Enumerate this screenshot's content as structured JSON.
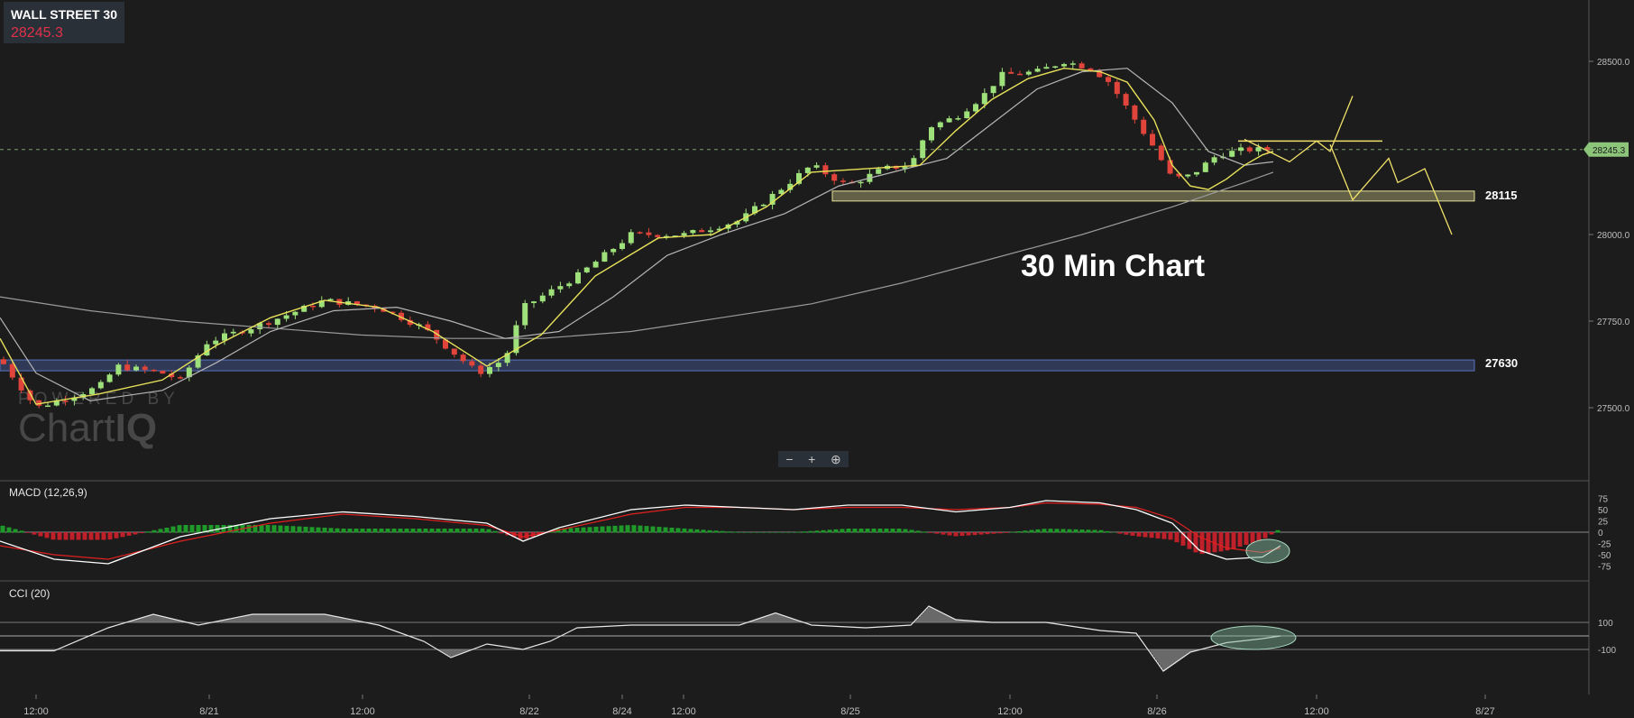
{
  "header": {
    "title": "WALL STREET 30",
    "price": "28245.3"
  },
  "annotation": "30 Min Chart",
  "watermark": {
    "top": "POWERED BY",
    "brand_left": "Chart",
    "brand_right": "IQ"
  },
  "zoom": {
    "minus": "−",
    "plus": "+",
    "reset": "⊕"
  },
  "colors": {
    "up": "#9ee07a",
    "down": "#e0443a",
    "ma_fast": "#e8e25a",
    "ma_slow": "#b5b5b5",
    "macd_line": "#ffffff",
    "signal_line": "#e02020",
    "support_zone": "#e6e39a",
    "lower_zone": "#4a5fa0",
    "price_badge": "#8cc47a"
  },
  "chart_data": [
    {
      "type": "candlestick",
      "title": "WALL STREET 30",
      "ylim": [
        27250,
        28600
      ],
      "y_ticks": [
        "28500.0",
        "28000.0",
        "27750.0",
        "27500.0"
      ],
      "x_ticks": [
        "12:00",
        "8/21",
        "12:00",
        "8/22",
        "8/24",
        "12:00",
        "8/25",
        "12:00",
        "8/26",
        "12:00",
        "8/27"
      ],
      "last_price_label": "28245.3",
      "levels": [
        {
          "label": "28115",
          "value": 28115
        },
        {
          "label": "27630",
          "value": 27630
        }
      ],
      "anchors": [
        {
          "x": 0,
          "y": 27640
        },
        {
          "x": 40,
          "y": 27500
        },
        {
          "x": 110,
          "y": 27560
        },
        {
          "x": 130,
          "y": 27620
        },
        {
          "x": 180,
          "y": 27600
        },
        {
          "x": 200,
          "y": 27580
        },
        {
          "x": 230,
          "y": 27690
        },
        {
          "x": 300,
          "y": 27750
        },
        {
          "x": 360,
          "y": 27810
        },
        {
          "x": 420,
          "y": 27790
        },
        {
          "x": 470,
          "y": 27730
        },
        {
          "x": 530,
          "y": 27600
        },
        {
          "x": 560,
          "y": 27640
        },
        {
          "x": 580,
          "y": 27790
        },
        {
          "x": 640,
          "y": 27880
        },
        {
          "x": 700,
          "y": 28000
        },
        {
          "x": 760,
          "y": 28000
        },
        {
          "x": 820,
          "y": 28040
        },
        {
          "x": 860,
          "y": 28120
        },
        {
          "x": 900,
          "y": 28200
        },
        {
          "x": 940,
          "y": 28140
        },
        {
          "x": 980,
          "y": 28190
        },
        {
          "x": 1010,
          "y": 28200
        },
        {
          "x": 1030,
          "y": 28310
        },
        {
          "x": 1060,
          "y": 28340
        },
        {
          "x": 1090,
          "y": 28400
        },
        {
          "x": 1110,
          "y": 28460
        },
        {
          "x": 1150,
          "y": 28470
        },
        {
          "x": 1180,
          "y": 28500
        },
        {
          "x": 1210,
          "y": 28480
        },
        {
          "x": 1230,
          "y": 28440
        },
        {
          "x": 1280,
          "y": 28250
        },
        {
          "x": 1300,
          "y": 28160
        },
        {
          "x": 1320,
          "y": 28170
        },
        {
          "x": 1350,
          "y": 28230
        },
        {
          "x": 1380,
          "y": 28245
        },
        {
          "x": 1412,
          "y": 28245
        }
      ],
      "ma_fast": [
        [
          0,
          27700
        ],
        [
          40,
          27510
        ],
        [
          110,
          27540
        ],
        [
          180,
          27580
        ],
        [
          240,
          27680
        ],
        [
          300,
          27760
        ],
        [
          360,
          27810
        ],
        [
          420,
          27790
        ],
        [
          480,
          27720
        ],
        [
          540,
          27620
        ],
        [
          600,
          27710
        ],
        [
          660,
          27880
        ],
        [
          730,
          27990
        ],
        [
          790,
          28000
        ],
        [
          850,
          28080
        ],
        [
          900,
          28180
        ],
        [
          960,
          28190
        ],
        [
          1020,
          28200
        ],
        [
          1060,
          28300
        ],
        [
          1100,
          28390
        ],
        [
          1140,
          28450
        ],
        [
          1180,
          28480
        ],
        [
          1220,
          28470
        ],
        [
          1250,
          28440
        ],
        [
          1280,
          28330
        ],
        [
          1300,
          28200
        ],
        [
          1320,
          28140
        ],
        [
          1340,
          28130
        ],
        [
          1360,
          28160
        ],
        [
          1380,
          28200
        ],
        [
          1400,
          28230
        ],
        [
          1412,
          28240
        ]
      ],
      "ma_slow": [
        [
          0,
          27760
        ],
        [
          40,
          27600
        ],
        [
          100,
          27520
        ],
        [
          180,
          27550
        ],
        [
          240,
          27630
        ],
        [
          300,
          27720
        ],
        [
          370,
          27780
        ],
        [
          440,
          27790
        ],
        [
          500,
          27750
        ],
        [
          560,
          27700
        ],
        [
          620,
          27720
        ],
        [
          680,
          27820
        ],
        [
          740,
          27940
        ],
        [
          800,
          28000
        ],
        [
          870,
          28060
        ],
        [
          930,
          28140
        ],
        [
          990,
          28180
        ],
        [
          1050,
          28220
        ],
        [
          1100,
          28320
        ],
        [
          1150,
          28420
        ],
        [
          1200,
          28470
        ],
        [
          1250,
          28480
        ],
        [
          1300,
          28380
        ],
        [
          1340,
          28240
        ],
        [
          1380,
          28200
        ],
        [
          1412,
          28210
        ]
      ],
      "ma_long": [
        [
          0,
          27820
        ],
        [
          100,
          27780
        ],
        [
          200,
          27750
        ],
        [
          300,
          27730
        ],
        [
          400,
          27710
        ],
        [
          500,
          27700
        ],
        [
          600,
          27700
        ],
        [
          700,
          27720
        ],
        [
          800,
          27760
        ],
        [
          900,
          27800
        ],
        [
          1000,
          27860
        ],
        [
          1100,
          27930
        ],
        [
          1200,
          28000
        ],
        [
          1300,
          28080
        ],
        [
          1380,
          28150
        ],
        [
          1412,
          28180
        ]
      ],
      "forecast_up": [
        [
          1380,
          28275
        ],
        [
          1430,
          28210
        ],
        [
          1460,
          28270
        ],
        [
          1475,
          28240
        ],
        [
          1500,
          28400
        ]
      ],
      "forecast_down": [
        [
          1475,
          28260
        ],
        [
          1500,
          28100
        ],
        [
          1520,
          28160
        ],
        [
          1540,
          28220
        ],
        [
          1550,
          28150
        ],
        [
          1580,
          28190
        ],
        [
          1610,
          28000
        ]
      ]
    },
    {
      "type": "macd",
      "title": "MACD (12,26,9)",
      "y_ticks": [
        "75",
        "50",
        "25",
        "0",
        "-25",
        "-50",
        "-75"
      ],
      "ylim": [
        -100,
        100
      ],
      "macd": [
        [
          0,
          -20
        ],
        [
          60,
          -60
        ],
        [
          120,
          -70
        ],
        [
          200,
          -10
        ],
        [
          300,
          30
        ],
        [
          380,
          45
        ],
        [
          460,
          35
        ],
        [
          540,
          20
        ],
        [
          580,
          -20
        ],
        [
          620,
          10
        ],
        [
          700,
          50
        ],
        [
          760,
          60
        ],
        [
          820,
          55
        ],
        [
          880,
          50
        ],
        [
          940,
          60
        ],
        [
          1000,
          60
        ],
        [
          1060,
          45
        ],
        [
          1120,
          55
        ],
        [
          1160,
          70
        ],
        [
          1220,
          65
        ],
        [
          1260,
          50
        ],
        [
          1300,
          20
        ],
        [
          1330,
          -40
        ],
        [
          1360,
          -60
        ],
        [
          1400,
          -55
        ],
        [
          1420,
          -30
        ]
      ],
      "signal": [
        [
          0,
          -30
        ],
        [
          60,
          -50
        ],
        [
          120,
          -60
        ],
        [
          200,
          -20
        ],
        [
          300,
          20
        ],
        [
          380,
          40
        ],
        [
          460,
          30
        ],
        [
          540,
          15
        ],
        [
          580,
          -10
        ],
        [
          620,
          5
        ],
        [
          700,
          40
        ],
        [
          760,
          55
        ],
        [
          820,
          55
        ],
        [
          880,
          50
        ],
        [
          940,
          55
        ],
        [
          1000,
          55
        ],
        [
          1060,
          50
        ],
        [
          1120,
          55
        ],
        [
          1160,
          65
        ],
        [
          1220,
          62
        ],
        [
          1260,
          55
        ],
        [
          1300,
          30
        ],
        [
          1330,
          -10
        ],
        [
          1360,
          -35
        ],
        [
          1400,
          -45
        ],
        [
          1420,
          -35
        ]
      ]
    },
    {
      "type": "cci",
      "title": "CCI (20)",
      "y_ticks": [
        "100",
        "-100"
      ],
      "ylim": [
        -250,
        250
      ],
      "values": [
        [
          0,
          -110
        ],
        [
          60,
          -110
        ],
        [
          120,
          60
        ],
        [
          170,
          160
        ],
        [
          220,
          80
        ],
        [
          280,
          160
        ],
        [
          360,
          160
        ],
        [
          420,
          80
        ],
        [
          470,
          -40
        ],
        [
          500,
          -160
        ],
        [
          540,
          -60
        ],
        [
          580,
          -100
        ],
        [
          610,
          -40
        ],
        [
          640,
          60
        ],
        [
          700,
          80
        ],
        [
          760,
          80
        ],
        [
          820,
          80
        ],
        [
          860,
          170
        ],
        [
          900,
          80
        ],
        [
          960,
          60
        ],
        [
          1010,
          80
        ],
        [
          1030,
          220
        ],
        [
          1060,
          120
        ],
        [
          1100,
          100
        ],
        [
          1160,
          100
        ],
        [
          1220,
          40
        ],
        [
          1260,
          20
        ],
        [
          1290,
          -260
        ],
        [
          1320,
          -120
        ],
        [
          1360,
          -50
        ],
        [
          1400,
          -20
        ],
        [
          1420,
          0
        ]
      ]
    }
  ]
}
